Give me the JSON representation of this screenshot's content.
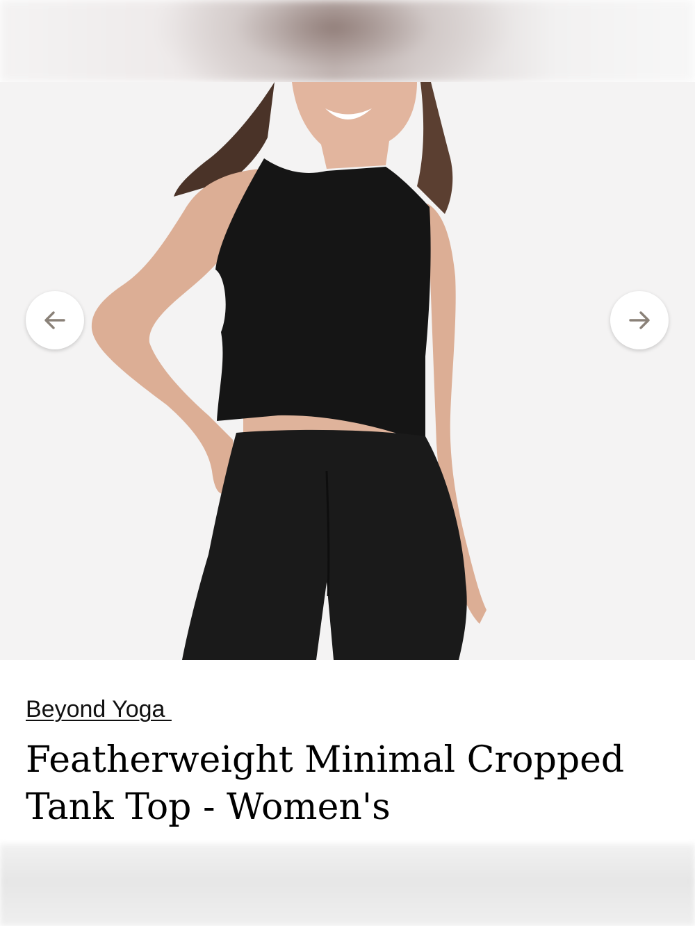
{
  "gallery": {
    "prev_icon": "arrow-left-icon",
    "next_icon": "arrow-right-icon",
    "image_alt": "Featherweight Minimal Cropped Tank Top - Women's"
  },
  "product": {
    "brand": "Beyond Yoga ",
    "title": "Featherweight Minimal Cropped Tank Top - Women's"
  },
  "colors": {
    "background": "#f4f3f3",
    "text": "#000000",
    "arrow": "#8a8178"
  }
}
